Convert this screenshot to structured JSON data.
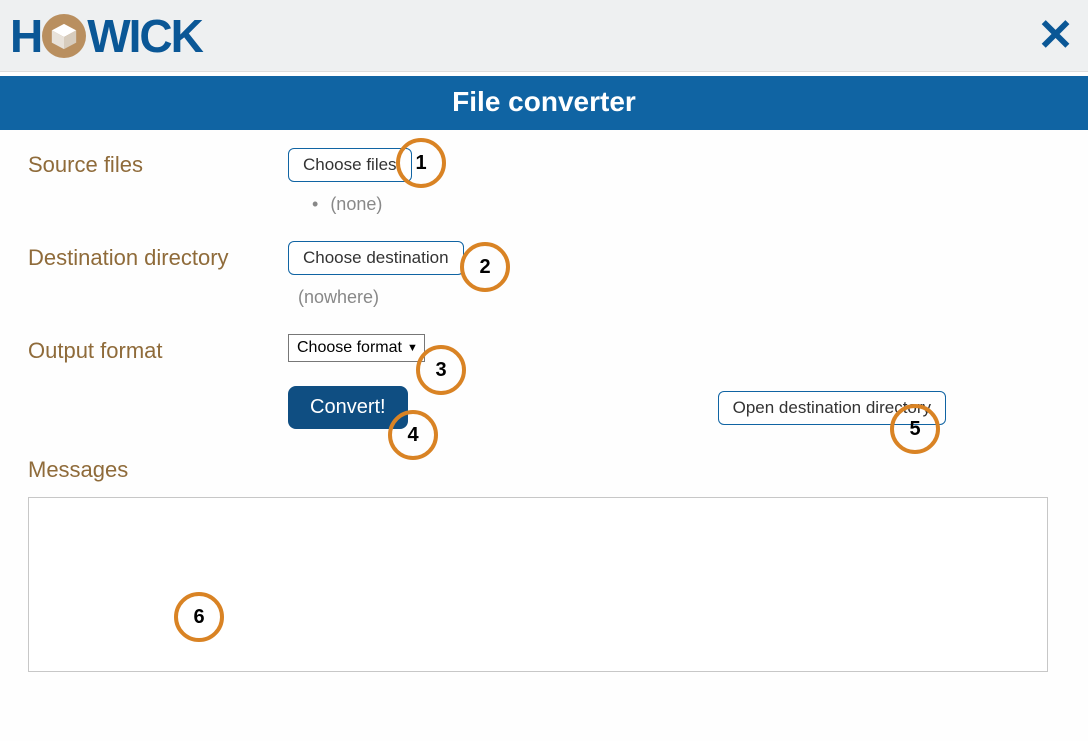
{
  "branding": {
    "logo_text_left": "H",
    "logo_text_right": "WICK"
  },
  "title": "File converter",
  "form": {
    "source_label": "Source files",
    "choose_files_btn": "Choose files",
    "source_none": "(none)",
    "dest_label": "Destination directory",
    "choose_dest_btn": "Choose destination",
    "dest_none": "(nowhere)",
    "format_label": "Output format",
    "format_select": "Choose format",
    "convert_btn": "Convert!",
    "open_dest_btn": "Open destination directory",
    "messages_label": "Messages"
  },
  "annotations": {
    "a1": "1",
    "a2": "2",
    "a3": "3",
    "a4": "4",
    "a5": "5",
    "a6": "6"
  }
}
